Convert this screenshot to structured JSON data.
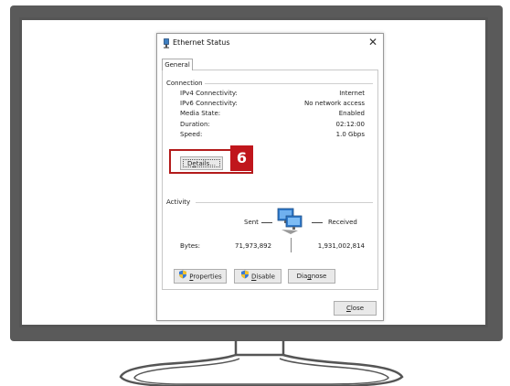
{
  "dialog": {
    "title": "Ethernet Status",
    "close_glyph": "✕",
    "tab_general": "General"
  },
  "connection": {
    "heading": "Connection",
    "rows": [
      {
        "label": "IPv4 Connectivity:",
        "value": "Internet"
      },
      {
        "label": "IPv6 Connectivity:",
        "value": "No network access"
      },
      {
        "label": "Media State:",
        "value": "Enabled"
      },
      {
        "label": "Duration:",
        "value": "02:12:00"
      },
      {
        "label": "Speed:",
        "value": "1.0 Gbps"
      }
    ],
    "details_button": {
      "pre": "D",
      "acc": "e",
      "post": "tails..."
    }
  },
  "activity": {
    "heading": "Activity",
    "sent_label": "Sent",
    "received_label": "Received",
    "bytes_label": "Bytes:",
    "bytes_sent": "71,973,892",
    "bytes_received": "1,931,002,814"
  },
  "buttons": {
    "properties": {
      "acc": "P",
      "rest": "roperties"
    },
    "disable": {
      "acc": "D",
      "rest": "isable"
    },
    "diagnose": {
      "pre": "Dia",
      "acc": "g",
      "post": "nose"
    },
    "close": {
      "acc": "C",
      "rest": "lose"
    }
  },
  "callout": {
    "step_number": "6",
    "color": "#c0161c"
  },
  "icons": [
    "network-adapter-icon",
    "close-icon",
    "network-computers-icon",
    "shield-icon"
  ]
}
